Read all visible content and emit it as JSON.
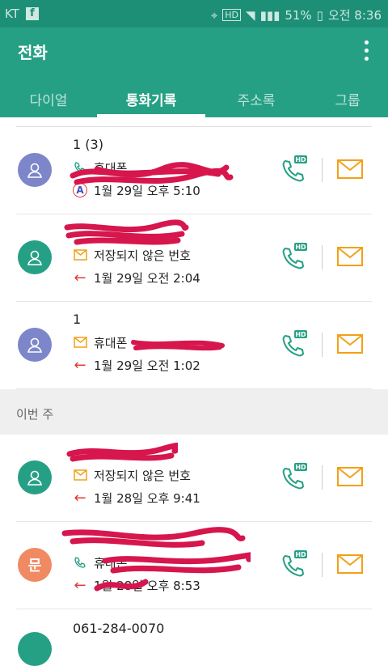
{
  "status": {
    "carrier": "KT",
    "battery": "51%",
    "time": "오전 8:36"
  },
  "app": {
    "title": "전화"
  },
  "tabs": [
    {
      "label": "다이얼"
    },
    {
      "label": "통화기록"
    },
    {
      "label": "주소록"
    },
    {
      "label": "그룹"
    }
  ],
  "entries_top": [
    {
      "name": "1 (3)",
      "detail": "휴대폰",
      "date": "1월 29일 오후 5:10",
      "avatar_color": "#7c86c9",
      "avatar_text": "",
      "type": "call"
    },
    {
      "name": "",
      "detail": "저장되지 않은 번호",
      "date": "1월 29일 오전 2:04",
      "avatar_color": "#26a085",
      "avatar_text": "",
      "type": "msg"
    },
    {
      "name": "1",
      "detail": "휴대폰",
      "date": "1월 29일 오전 1:02",
      "avatar_color": "#7c86c9",
      "avatar_text": "",
      "type": "msg"
    }
  ],
  "section_label": "이번 주",
  "entries_week": [
    {
      "name": "",
      "detail": "저장되지 않은 번호",
      "date": "1월 28일 오후 9:41",
      "avatar_color": "#26a085",
      "avatar_text": "",
      "type": "msg"
    },
    {
      "name": "",
      "detail": "휴대폰",
      "date": "1월 28일 오후 8:53",
      "avatar_color": "#f08a63",
      "avatar_text": "문",
      "type": "call"
    }
  ],
  "last_entry": {
    "name": "061-284-0070"
  },
  "colors": {
    "accent": "#26a085",
    "message": "#f2a017",
    "missed": "#e23b3b",
    "hd": "#26a085"
  }
}
